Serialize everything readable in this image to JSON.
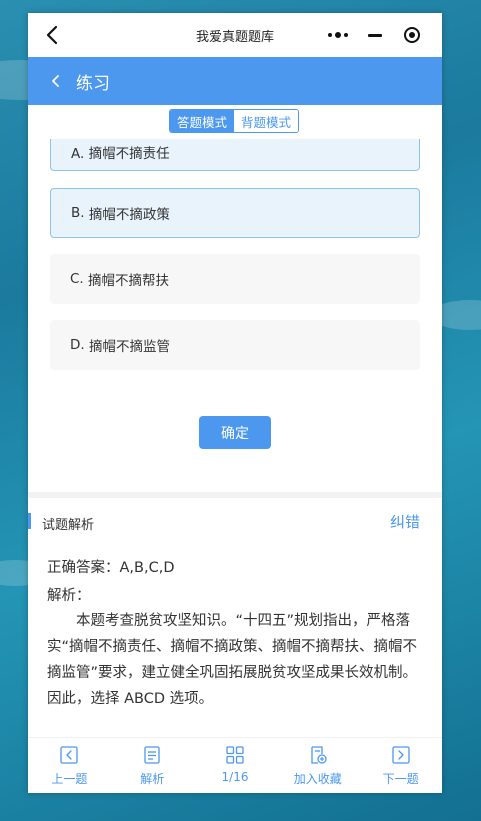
{
  "window": {
    "app_title": "我爱真题题库"
  },
  "navbar": {
    "title": "练习"
  },
  "mode_switch": {
    "tabs": [
      {
        "label": "答题模式",
        "active": true
      },
      {
        "label": "背题模式",
        "active": false
      }
    ]
  },
  "options": [
    {
      "letter": "A.",
      "text": "摘帽不摘责任",
      "selected": true
    },
    {
      "letter": "B.",
      "text": "摘帽不摘政策",
      "selected": true
    },
    {
      "letter": "C.",
      "text": "摘帽不摘帮扶",
      "selected": false
    },
    {
      "letter": "D.",
      "text": "摘帽不摘监管",
      "selected": false
    }
  ],
  "confirm_label": "确定",
  "analysis": {
    "title": "试题解析",
    "report_label": "纠错",
    "answer_line": "正确答案：A,B,C,D",
    "explanation_label": "解析：",
    "explanation": "本题考查脱贫攻坚知识。“十四五”规划指出，严格落实“摘帽不摘责任、摘帽不摘政策、摘帽不摘帮扶、摘帽不摘监管”要求，建立健全巩固拓展脱贫攻坚成果长效机制。 因此，选择 ABCD 选项。"
  },
  "bottom_bar": [
    {
      "label": "上一题",
      "icon": "chevron-left-icon"
    },
    {
      "label": "解析",
      "icon": "document-icon"
    },
    {
      "label": "1/16",
      "icon": "grid-icon"
    },
    {
      "label": "加入收藏",
      "icon": "bookmark-add-icon"
    },
    {
      "label": "下一题",
      "icon": "chevron-right-icon"
    }
  ],
  "colors": {
    "accent": "#4c98ef",
    "selected_bg": "#e8f3fc",
    "option_bg": "#f7f7f7"
  }
}
